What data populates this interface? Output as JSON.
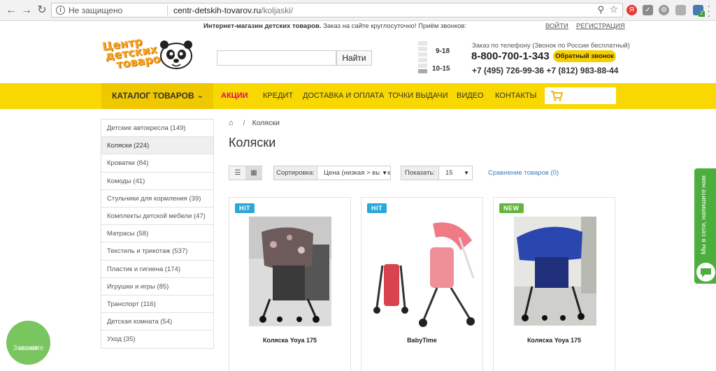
{
  "browser": {
    "security_label": "Не защищено",
    "url_host": "centr-detskih-tovarov.ru",
    "url_path": "/koljaski/",
    "ext_badge": "2"
  },
  "topbar": {
    "shop_name": "Интернет-магазин детских товаров.",
    "tagline": "Заказ на сайте круглосуточно! Приём звонков:",
    "login": "ВОЙТИ",
    "register": "РЕГИСТРАЦИЯ"
  },
  "header": {
    "logo_line1": "Центр",
    "logo_line2": "детских",
    "logo_line3": "товаров",
    "search_placeholder": "",
    "search_button": "Найти",
    "hours_top": "9-18",
    "hours_bottom": "10-15",
    "phone_note": "Заказ по телефону (Звонок по России бесплатный)",
    "phone_main": "8-800-700-1-343",
    "callback": "Обратный звонок",
    "phones_other": "+7 (495) 726-99-36 +7 (812) 983-88-44"
  },
  "nav": {
    "catalog": "КАТАЛОГ ТОВАРОВ",
    "items": [
      "АКЦИИ",
      "КРЕДИТ",
      "ДОСТАВКА И ОПЛАТА",
      "ТОЧКИ ВЫДАЧИ",
      "ВИДЕО",
      "КОНТАКТЫ"
    ],
    "accent_color": "#e0007a",
    "bar_color": "#f8d800"
  },
  "sidebar": {
    "items": [
      "Детские автокресла (149)",
      "Коляски (224)",
      "Кроватки (84)",
      "Комоды (41)",
      "Стульчики для кормления (39)",
      "Комплекты детской мебели (47)",
      "Матрасы (58)",
      "Текстиль и трикотаж (537)",
      "Пластик и гигиена (174)",
      "Игрушки и игры (85)",
      "Транспорт (116)",
      "Детская комната (54)",
      "Уход (35)"
    ],
    "active_index": 1
  },
  "main": {
    "breadcrumb_current": "Коляски",
    "title": "Коляски",
    "sort_label": "Сортировка:",
    "sort_value": "Цена (низкая > высокая)",
    "show_label": "Показать:",
    "show_value": "15",
    "compare": "Сравнение товаров (0)"
  },
  "products": [
    {
      "badge": "HIT",
      "name": "Коляска Yoya 175"
    },
    {
      "badge": "HIT",
      "name": "BabyTime"
    },
    {
      "badge": "NEW",
      "name": "Коляска Yoya 175"
    }
  ],
  "widgets": {
    "chat": "Мы в сети, напишите нам",
    "order_call_line1": "Закажите",
    "order_call_line2": "звонок"
  }
}
